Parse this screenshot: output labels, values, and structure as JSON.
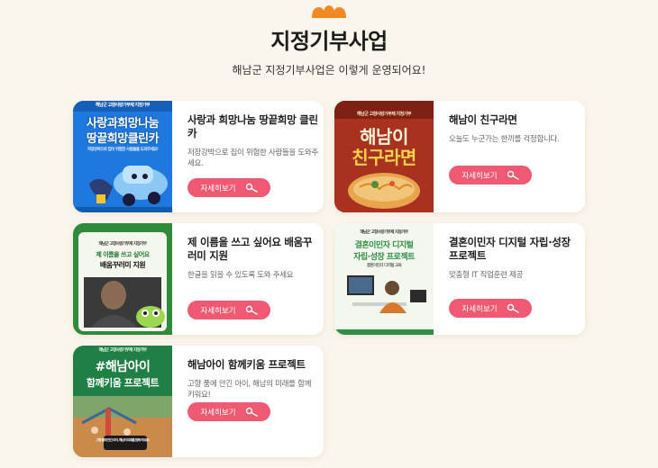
{
  "header": {
    "title": "지정기부사업",
    "subtitle": "해남군 지정기부사업은 이렇게 운영되어요!"
  },
  "button_label": "자세히보기",
  "cards": [
    {
      "title": "사랑과 희망나눔 땅끝희망 클린카",
      "desc": "저장강박으로 집이 위험한 사람들을 도와주세요.",
      "thumb": {
        "top": "해남군 고향사랑기부제 지정기부",
        "line1": "사랑과희망나눔",
        "line2": "땅끝희망클린카",
        "sub": "저장강박으로 집이 위험한 사람들을 도와주세요!"
      }
    },
    {
      "title": "해남이 친구라면",
      "desc": "오늘도 누군가는 한끼를 걱정합니다.",
      "thumb": {
        "top": "해남군 고향사랑기부제 지정기부",
        "line1": "해남이",
        "line2": "친구라면"
      }
    },
    {
      "title": "제 이름을 쓰고 싶어요 배움꾸러미 지원",
      "desc": "한글을 읽을 수 있도록 도와 주세요",
      "thumb": {
        "top": "해남군 고향사랑기부제 지정기부",
        "line1": "제 이름을 쓰고 싶어요",
        "line2": "배움꾸러미 지원"
      }
    },
    {
      "title": "결혼이민자 디지털 자립·성장 프로젝트",
      "desc": "맞춤형 IT 직업훈련 제공",
      "thumb": {
        "top": "해남군 고향사랑기부제 지정기부",
        "line1": "결혼이민자 디지털",
        "line2": "자립·성장 프로젝트",
        "sub": "결혼이민자 디지털 교육"
      }
    },
    {
      "title": "해남아이 함께키움 프로젝트",
      "desc": "고향 품에 안긴 아이, 해남의 미래를 함께 키워요!",
      "thumb": {
        "top": "해남군 고향사랑기부제 지정기부",
        "line1": "#해남아이",
        "line2": "함께키움 프로젝트",
        "sub": "고향 품에 안긴 아이, 해남의 미래를 함께 키워요!"
      }
    }
  ],
  "colors": {
    "background": "#fbf6ec",
    "accent_button": "#ef5a72",
    "deco_orange": "#f08a24"
  }
}
